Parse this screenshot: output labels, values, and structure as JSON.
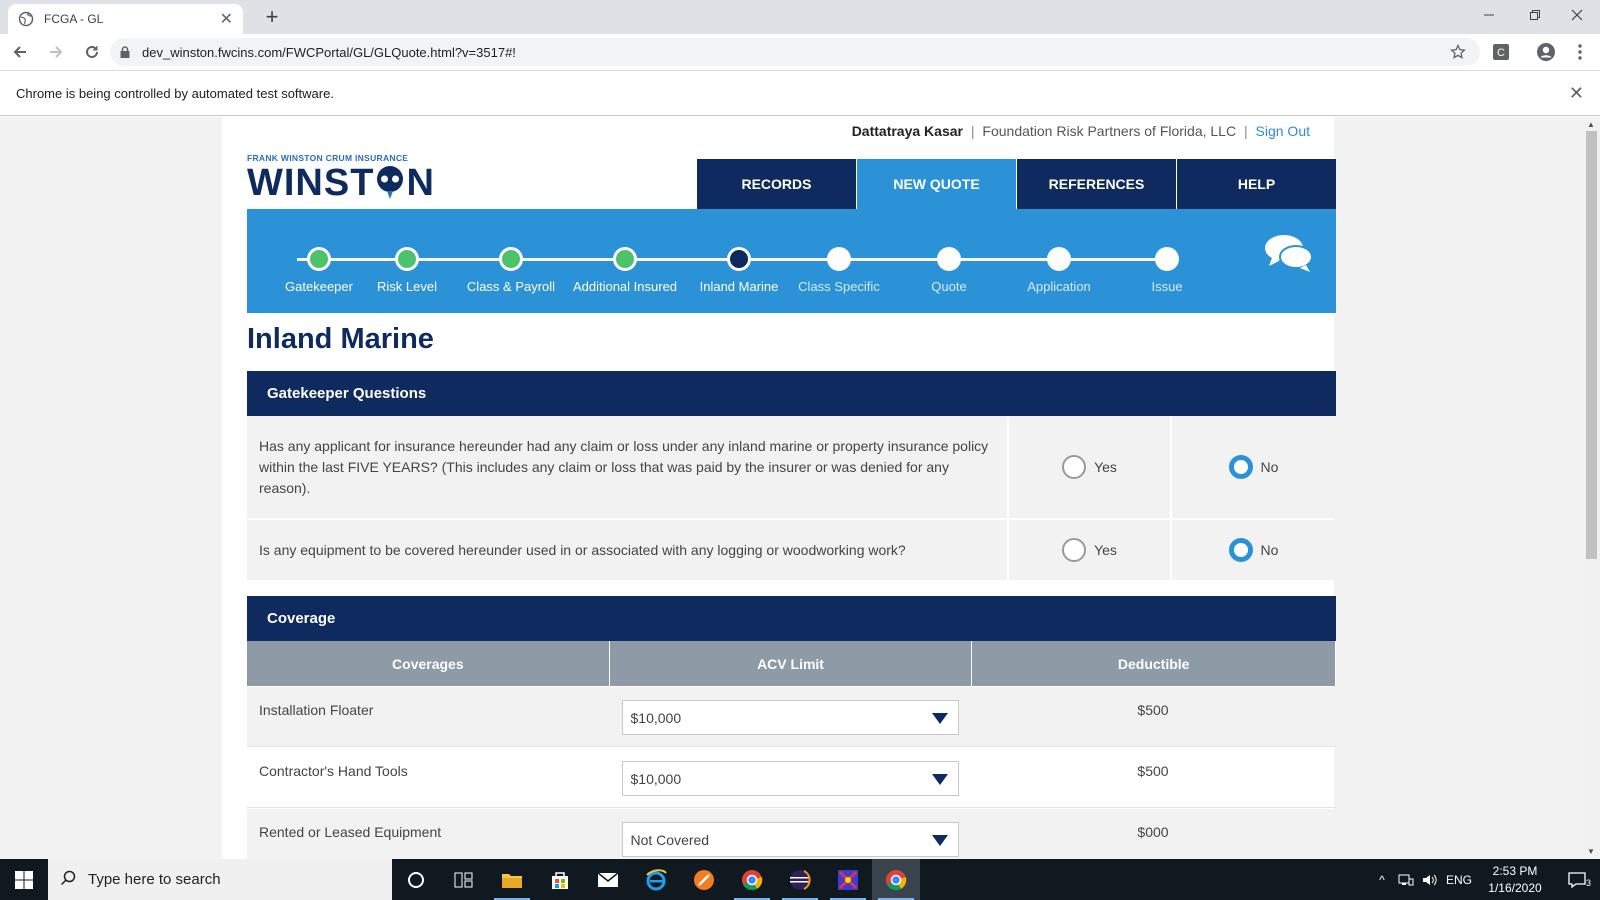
{
  "browser": {
    "tab_title": "FCGA - GL",
    "url": "dev_winston.fwcins.com/FWCPortal/GL/GLQuote.html?v=3517#!",
    "infobar_message": "Chrome is being controlled by automated test software.",
    "profile_initial": "C"
  },
  "header": {
    "user_name": "Dattatraya Kasar",
    "separator": "|",
    "org_name": "Foundation Risk Partners of Florida, LLC",
    "sign_out": "Sign Out",
    "logo_small": "FRANK WINSTON CRUM INSURANCE",
    "logo_left": "WINST",
    "logo_right": "N"
  },
  "nav": [
    {
      "label": "RECORDS",
      "active": false
    },
    {
      "label": "NEW QUOTE",
      "active": true
    },
    {
      "label": "REFERENCES",
      "active": false
    },
    {
      "label": "HELP",
      "active": false
    }
  ],
  "steps": [
    {
      "label": "Gatekeeper",
      "state": "done"
    },
    {
      "label": "Risk Level",
      "state": "done"
    },
    {
      "label": "Class & Payroll",
      "state": "done"
    },
    {
      "label": "Additional Insured",
      "state": "done"
    },
    {
      "label": "Inland Marine",
      "state": "current"
    },
    {
      "label": "Class Specific",
      "state": "pending"
    },
    {
      "label": "Quote",
      "state": "pending"
    },
    {
      "label": "Application",
      "state": "pending"
    },
    {
      "label": "Issue",
      "state": "pending"
    }
  ],
  "page_title": "Inland Marine",
  "gatekeeper": {
    "header": "Gatekeeper Questions",
    "yes_label": "Yes",
    "no_label": "No",
    "questions": [
      {
        "text": "Has any applicant for insurance hereunder had any claim or loss under any inland marine or property insurance policy within the last FIVE YEARS? (This includes any claim or loss that was paid by the insurer or was denied for any reason).",
        "answer": "No"
      },
      {
        "text": "Is any equipment to be covered hereunder used in or associated with any logging or woodworking work?",
        "answer": "No"
      }
    ]
  },
  "coverage": {
    "header": "Coverage",
    "columns": [
      "Coverages",
      "ACV Limit",
      "Deductible"
    ],
    "rows": [
      {
        "name": "Installation Floater",
        "limit": "$10,000",
        "deductible": "$500"
      },
      {
        "name": "Contractor's Hand Tools",
        "limit": "$10,000",
        "deductible": "$500"
      },
      {
        "name": "Rented or Leased Equipment",
        "limit": "Not Covered",
        "deductible": "$000"
      }
    ]
  },
  "taskbar": {
    "search_placeholder": "Type here to search",
    "lang": "ENG",
    "time": "2:53 PM",
    "date": "1/16/2020",
    "notification_count": "3"
  }
}
